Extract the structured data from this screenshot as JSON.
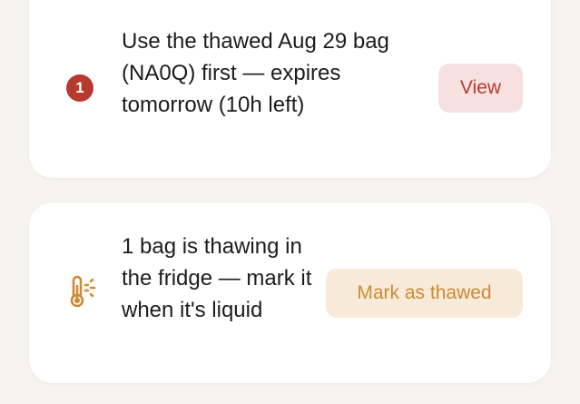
{
  "colors": {
    "background": "#f7f3ee",
    "card": "#ffffff",
    "alert_red": "#b63a2f",
    "alert_red_bg": "#f6e1e0",
    "warm_orange": "#cd8a35",
    "warm_orange_bg": "#f8ead9",
    "text": "#1c1c1e"
  },
  "alerts": [
    {
      "badge_count": "1",
      "message": "Use the thawed Aug 29 bag (NA0Q) first — expires tomorrow (10h left)",
      "action_label": "View"
    },
    {
      "icon": "thermometer-sun-icon",
      "message": "1 bag is thawing in the fridge — mark it when it's liquid",
      "action_label": "Mark as thawed"
    }
  ]
}
